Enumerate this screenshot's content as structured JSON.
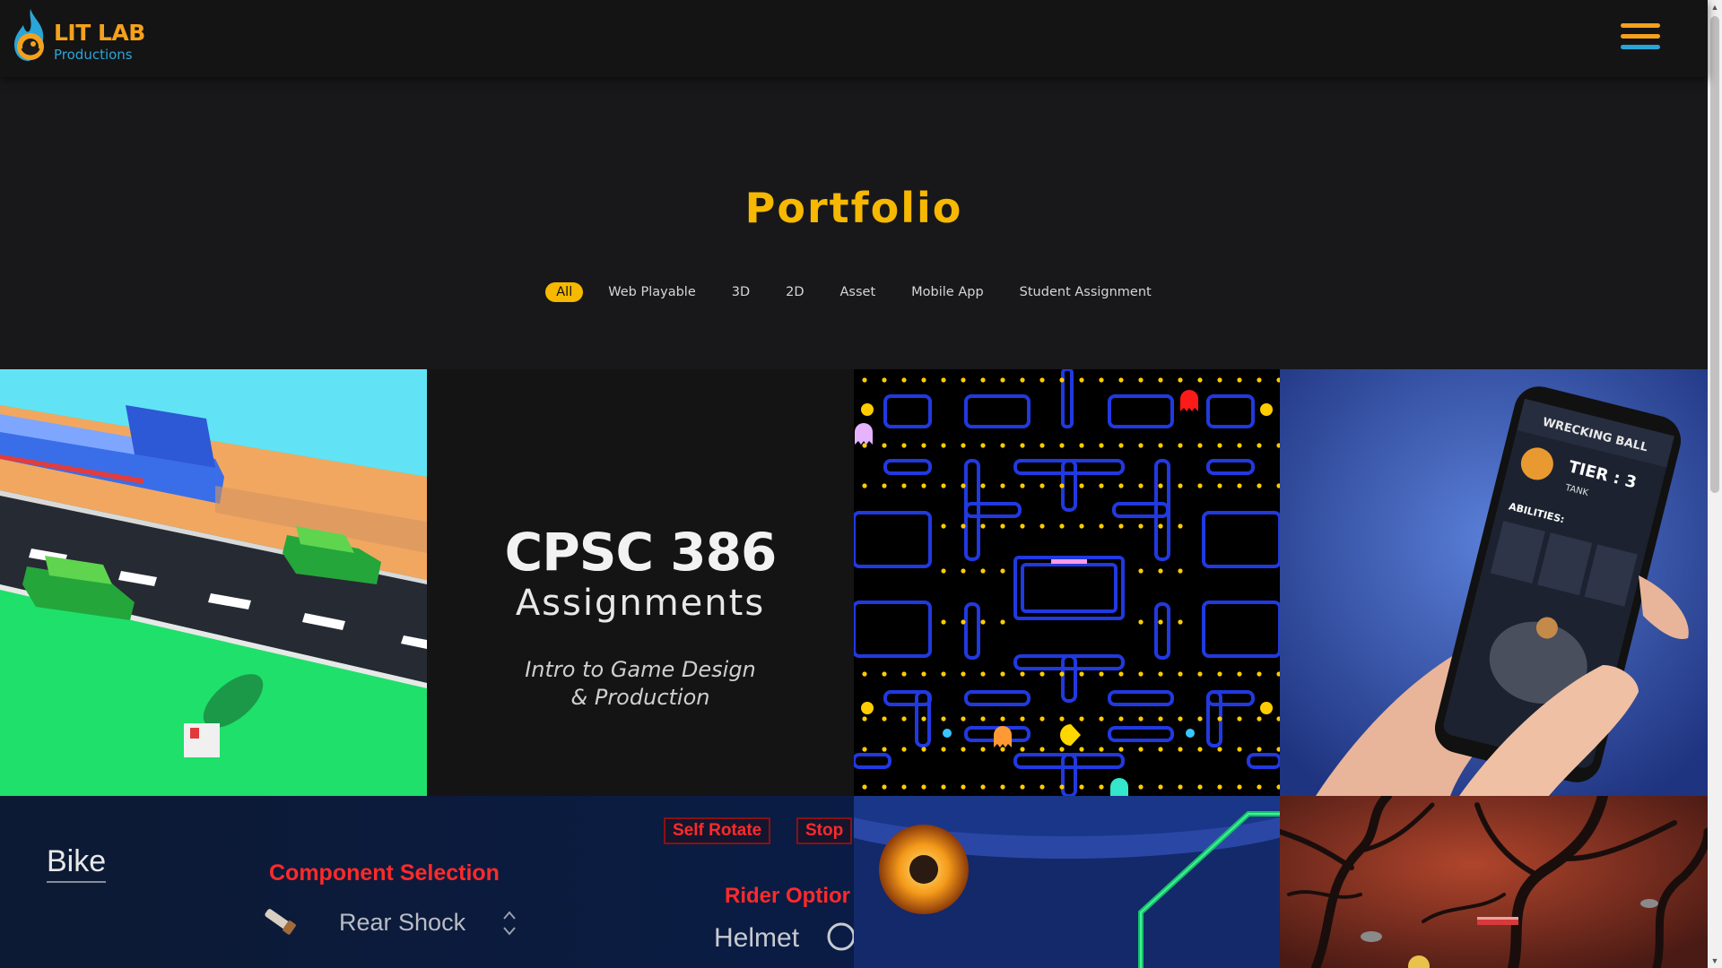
{
  "header": {
    "logo_title": "LIT LAB",
    "logo_subtitle": "Productions",
    "menu_icon": "hamburger-menu-icon"
  },
  "page": {
    "title": "Portfolio"
  },
  "filters": [
    {
      "label": "All",
      "active": true
    },
    {
      "label": "Web Playable",
      "active": false
    },
    {
      "label": "3D",
      "active": false
    },
    {
      "label": "2D",
      "active": false
    },
    {
      "label": "Asset",
      "active": false
    },
    {
      "label": "Mobile App",
      "active": false
    },
    {
      "label": "Student Assignment",
      "active": false
    }
  ],
  "tiles": {
    "cpsc": {
      "title": "CPSC 386",
      "subtitle": "Assignments",
      "desc_line1": "Intro to Game Design",
      "desc_line2": "& Production"
    },
    "wrecking_ball": {
      "app_title": "WRECKING BALL",
      "tier": "TIER : 3",
      "role": "TANK",
      "abilities": "ABILITIES:"
    },
    "bike": {
      "bike_label": "Bike",
      "component_selection": "Component Selection",
      "rear_shock": "Rear Shock",
      "rider_options": "Rider Optior",
      "helmet": "Helmet",
      "self_rotate": "Self Rotate",
      "stop": "Stop"
    }
  },
  "colors": {
    "accent": "#f6b800",
    "logo_orange": "#f4a11c",
    "logo_blue": "#2aa5d8",
    "background": "#18181a",
    "header": "#141414",
    "hamburger_top": "#f4a11c",
    "hamburger_mid": "#f4a11c",
    "hamburger_bottom": "#2aa5d8"
  }
}
